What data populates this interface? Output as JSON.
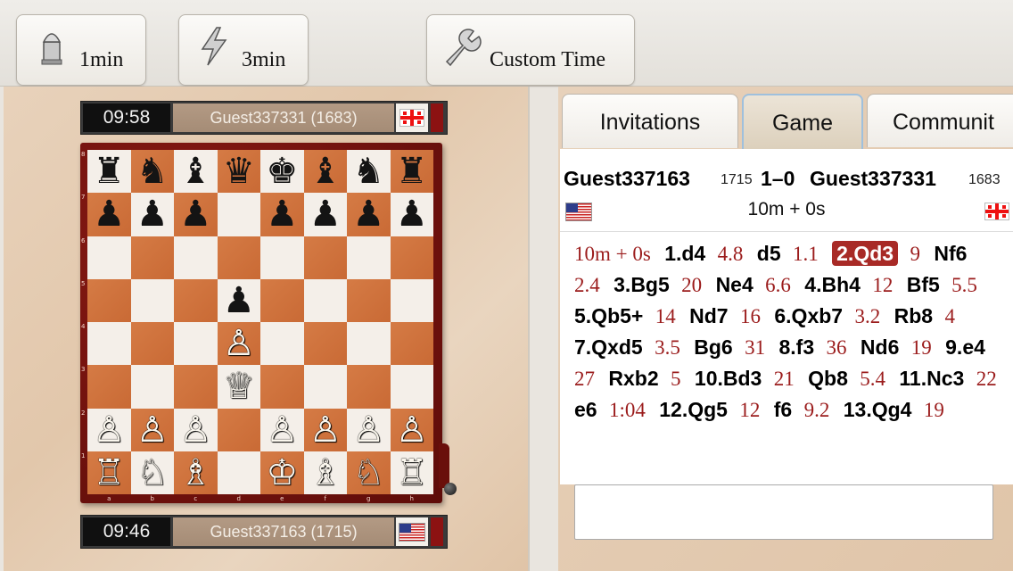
{
  "toolbar": {
    "buttons": [
      {
        "label": "1min",
        "icon": "bullet-icon"
      },
      {
        "label": "3min",
        "icon": "lightning-icon"
      },
      {
        "label": "Custom Time",
        "icon": "wrench-icon"
      }
    ]
  },
  "top_player": {
    "clock": "09:58",
    "name": "Guest337331 (1683)",
    "flag": "georgia-flag-icon"
  },
  "bottom_player": {
    "clock": "09:46",
    "name": "Guest337163 (1715)",
    "flag": "usa-flag-icon"
  },
  "board": {
    "files": [
      "a",
      "b",
      "c",
      "d",
      "e",
      "f",
      "g",
      "h"
    ],
    "ranks": [
      "8",
      "7",
      "6",
      "5",
      "4",
      "3",
      "2",
      "1"
    ],
    "position": [
      [
        "♜",
        "♞",
        "♝",
        "♛",
        "♚",
        "♝",
        "♞",
        "♜"
      ],
      [
        "♟",
        "♟",
        "♟",
        "",
        "♟",
        "♟",
        "♟",
        "♟"
      ],
      [
        "",
        "",
        "",
        "",
        "",
        "",
        "",
        ""
      ],
      [
        "",
        "",
        "",
        "♟",
        "",
        "",
        "",
        ""
      ],
      [
        "",
        "",
        "",
        "♙",
        "",
        "",
        "",
        ""
      ],
      [
        "",
        "",
        "",
        "♕",
        "",
        "",
        "",
        ""
      ],
      [
        "♙",
        "♙",
        "♙",
        "",
        "♙",
        "♙",
        "♙",
        "♙"
      ],
      [
        "♖",
        "♘",
        "♗",
        "",
        "♔",
        "♗",
        "♘",
        "♖"
      ]
    ]
  },
  "tabs": [
    {
      "label": "Invitations",
      "active": false
    },
    {
      "label": "Game",
      "active": true
    },
    {
      "label": "Communit",
      "active": false
    }
  ],
  "game": {
    "white_name": "Guest337163",
    "white_rating": "1715",
    "result": "1–0",
    "black_name": "Guest337331",
    "black_rating": "1683",
    "time_control": "10m + 0s"
  },
  "moves": [
    {
      "t": "tm",
      "v": "10m + 0s"
    },
    {
      "t": "mv",
      "v": "1.d4"
    },
    {
      "t": "tm",
      "v": "4.8"
    },
    {
      "t": "mv",
      "v": "d5"
    },
    {
      "t": "tm",
      "v": "1.1"
    },
    {
      "t": "cur",
      "v": "2.Qd3"
    },
    {
      "t": "tm",
      "v": "9"
    },
    {
      "t": "mv",
      "v": "Nf6"
    },
    {
      "t": "tm",
      "v": "2.4"
    },
    {
      "t": "mv",
      "v": "3.Bg5"
    },
    {
      "t": "tm",
      "v": "20"
    },
    {
      "t": "mv",
      "v": "Ne4"
    },
    {
      "t": "tm",
      "v": "6.6"
    },
    {
      "t": "mv",
      "v": "4.Bh4"
    },
    {
      "t": "tm",
      "v": "12"
    },
    {
      "t": "mv",
      "v": "Bf5"
    },
    {
      "t": "tm",
      "v": "5.5"
    },
    {
      "t": "mv",
      "v": "5.Qb5+"
    },
    {
      "t": "tm",
      "v": "14"
    },
    {
      "t": "mv",
      "v": "Nd7"
    },
    {
      "t": "tm",
      "v": "16"
    },
    {
      "t": "mv",
      "v": "6.Qxb7"
    },
    {
      "t": "tm",
      "v": "3.2"
    },
    {
      "t": "mv",
      "v": "Rb8"
    },
    {
      "t": "tm",
      "v": "4"
    },
    {
      "t": "mv",
      "v": "7.Qxd5"
    },
    {
      "t": "tm",
      "v": "3.5"
    },
    {
      "t": "mv",
      "v": "Bg6"
    },
    {
      "t": "tm",
      "v": "31"
    },
    {
      "t": "mv",
      "v": "8.f3"
    },
    {
      "t": "tm",
      "v": "36"
    },
    {
      "t": "mv",
      "v": "Nd6"
    },
    {
      "t": "tm",
      "v": "19"
    },
    {
      "t": "mv",
      "v": "9.e4"
    },
    {
      "t": "tm",
      "v": "27"
    },
    {
      "t": "mv",
      "v": "Rxb2"
    },
    {
      "t": "tm",
      "v": "5"
    },
    {
      "t": "mv",
      "v": "10.Bd3"
    },
    {
      "t": "tm",
      "v": "21"
    },
    {
      "t": "mv",
      "v": "Qb8"
    },
    {
      "t": "tm",
      "v": "5.4"
    },
    {
      "t": "mv",
      "v": "11.Nc3"
    },
    {
      "t": "tm",
      "v": "22"
    },
    {
      "t": "mv",
      "v": "e6"
    },
    {
      "t": "tm",
      "v": "1:04"
    },
    {
      "t": "mv",
      "v": "12.Qg5"
    },
    {
      "t": "tm",
      "v": "12"
    },
    {
      "t": "mv",
      "v": "f6"
    },
    {
      "t": "tm",
      "v": "9.2"
    },
    {
      "t": "mv",
      "v": "13.Qg4"
    },
    {
      "t": "tm",
      "v": "19"
    }
  ]
}
